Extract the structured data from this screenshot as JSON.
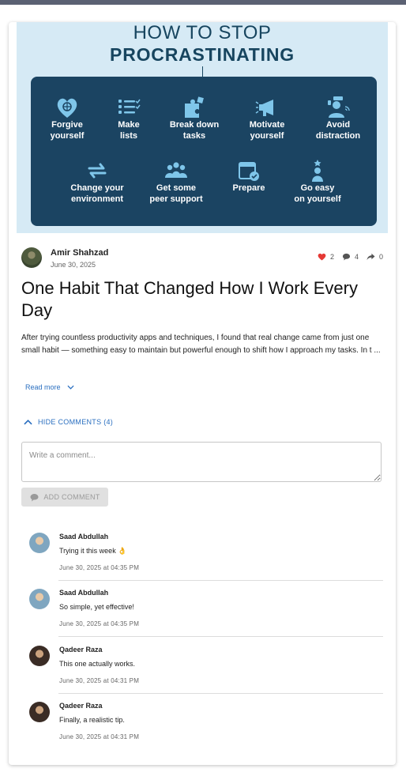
{
  "hero": {
    "title_line1": "HOW TO STOP",
    "title_line2": "PROCRASTINATING",
    "tips": [
      {
        "icon": "heart-brain-icon",
        "label": "Forgive\nyourself"
      },
      {
        "icon": "checklist-icon",
        "label": "Make\nlists"
      },
      {
        "icon": "puzzle-icon",
        "label": "Break down\ntasks"
      },
      {
        "icon": "megaphone-icon",
        "label": "Motivate\nyourself"
      },
      {
        "icon": "person-distraction-icon",
        "label": "Avoid\ndistraction"
      },
      {
        "icon": "arrows-swap-icon",
        "label": "Change your\nenvironment"
      },
      {
        "icon": "group-icon",
        "label": "Get some\npeer support"
      },
      {
        "icon": "calendar-check-icon",
        "label": "Prepare"
      },
      {
        "icon": "person-star-icon",
        "label": "Go easy\non yourself"
      }
    ]
  },
  "post": {
    "author": "Amir Shahzad",
    "date": "June 30, 2025",
    "likes": "2",
    "comments_count": "4",
    "shares": "0",
    "title": "One Habit That Changed How I Work Every Day",
    "excerpt": "After trying countless productivity apps and techniques, I found that real change came from just one small habit — something easy to maintain but powerful enough to shift how I approach my tasks. In t ...",
    "read_more": "Read more"
  },
  "comments_section": {
    "toggle_label": "HIDE COMMENTS (4)",
    "input_placeholder": "Write a comment...",
    "add_button": "ADD COMMENT",
    "comments": [
      {
        "name": "Saad Abdullah",
        "text": "Trying it this week 👌",
        "time": "June 30, 2025 at 04:35 PM"
      },
      {
        "name": "Saad Abdullah",
        "text": "So simple, yet effective!",
        "time": "June 30, 2025 at 04:35 PM"
      },
      {
        "name": "Qadeer Raza",
        "text": "This one actually works.",
        "time": "June 30, 2025 at 04:31 PM"
      },
      {
        "name": "Qadeer Raza",
        "text": "Finally, a realistic tip.",
        "time": "June 30, 2025 at 04:31 PM"
      }
    ]
  },
  "colors": {
    "accent": "#2a6fc0",
    "panel": "#1b4462",
    "hero_bg": "#d6eaf5",
    "like": "#e53935"
  }
}
